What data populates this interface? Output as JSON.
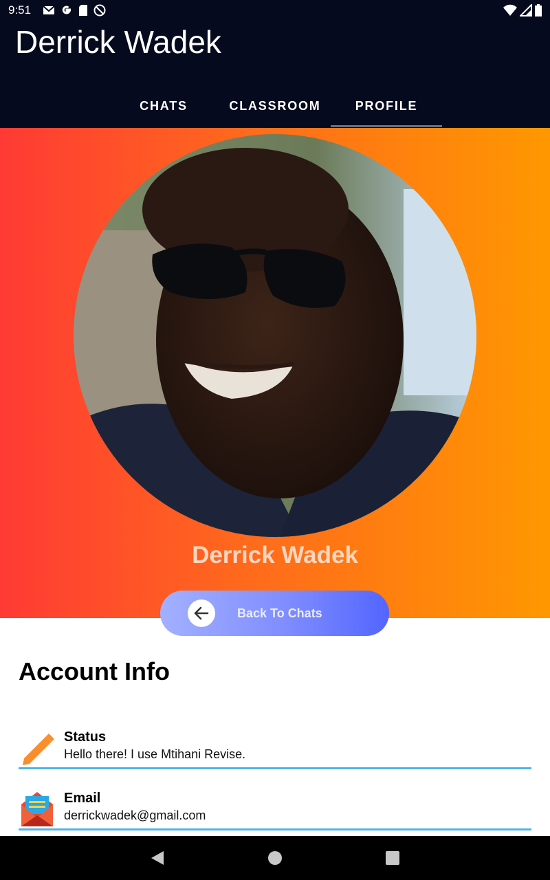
{
  "status_bar": {
    "time": "9:51",
    "left_icons": [
      "gmail-icon",
      "google-icon",
      "sd-card-icon",
      "do-not-disturb-icon"
    ],
    "right_icons": [
      "wifi-icon",
      "cell-signal-icon",
      "battery-icon"
    ]
  },
  "app_bar": {
    "title": "Derrick Wadek",
    "tabs": [
      {
        "label": "CHATS",
        "selected": false
      },
      {
        "label": "CLASSROOM",
        "selected": false
      },
      {
        "label": "PROFILE",
        "selected": true
      }
    ]
  },
  "profile": {
    "name": "Derrick Wadek",
    "back_button_label": "Back To Chats"
  },
  "account_info": {
    "heading": "Account Info",
    "rows": [
      {
        "label": "Status",
        "value": "Hello there! I use Mtihani Revise.",
        "icon": "pencil-icon"
      },
      {
        "label": "Email",
        "value": "derrickwadek@gmail.com",
        "icon": "email-envelope-icon"
      }
    ]
  },
  "colors": {
    "app_bar": "#050a1e",
    "gradient_start": "#ff3a34",
    "gradient_end": "#ff9800",
    "button_start": "#a3b0ff",
    "button_end": "#5265ff",
    "divider": "#4fb3e8"
  }
}
